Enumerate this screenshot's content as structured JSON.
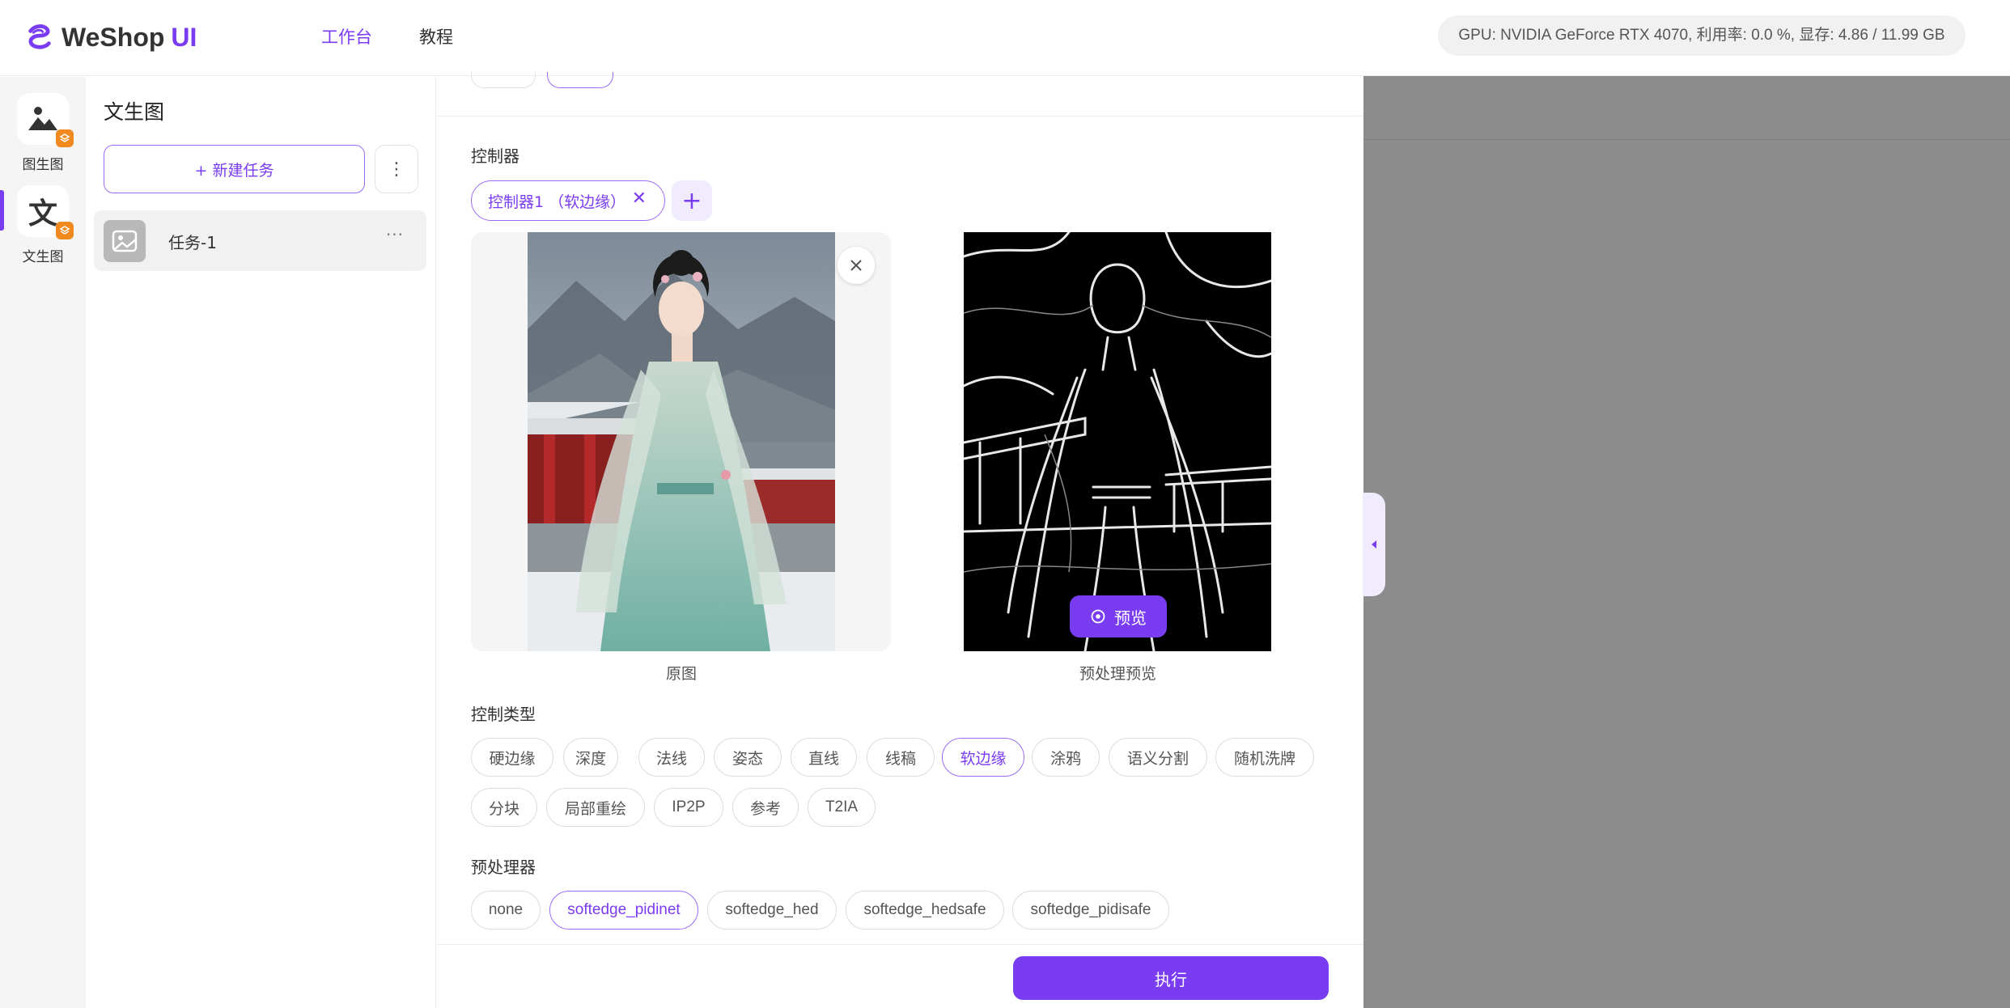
{
  "header": {
    "logo_text": "WeShop",
    "logo_ui": "UI",
    "nav": [
      "工作台",
      "教程"
    ],
    "gpu_status": "GPU: NVIDIA GeForce RTX 4070, 利用率: 0.0 %, 显存: 4.86 / 11.99 GB"
  },
  "rail": {
    "items": [
      {
        "label": "图生图",
        "icon": "mountain-image-icon"
      },
      {
        "label": "文生图",
        "icon": "text-wen-icon"
      }
    ]
  },
  "tasks": {
    "title": "文生图",
    "new_task_label": "+ 新建任务",
    "more_label": "⋮",
    "items": [
      {
        "name": "任务-1",
        "menu": "···"
      }
    ]
  },
  "editor": {
    "controller_label": "控制器",
    "controller_chip": "控制器1 （软边缘）",
    "controller_close": "✕",
    "add_label": "+",
    "original_caption": "原图",
    "preprocess_caption": "预处理预览",
    "preview_button": "预览",
    "control_type_label": "控制类型",
    "control_types": [
      "硬边缘",
      "深度",
      "法线",
      "姿态",
      "直线",
      "线稿",
      "软边缘",
      "涂鸦",
      "语义分割",
      "随机洗牌",
      "分块",
      "局部重绘",
      "IP2P",
      "参考",
      "T2IA"
    ],
    "control_type_selected": "软边缘",
    "preprocessor_label": "预处理器",
    "preprocessors": [
      "none",
      "softedge_pidinet",
      "softedge_hed",
      "softedge_hedsafe",
      "softedge_pidisafe"
    ],
    "preprocessor_selected": "softedge_pidinet",
    "execute_label": "执行"
  },
  "colors": {
    "accent": "#7a3cf0",
    "badge": "#f08a1e",
    "right_panel": "#8c8c8c"
  }
}
